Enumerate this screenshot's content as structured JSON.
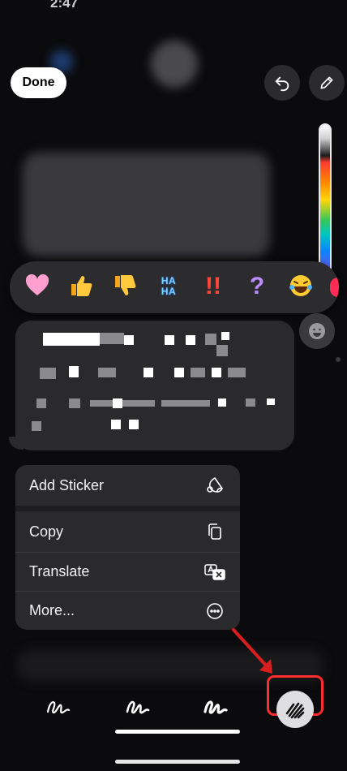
{
  "status": {
    "time": "2:47"
  },
  "toolbar": {
    "done_label": "Done",
    "undo_icon": "undo-icon",
    "pen_icon": "pencil-icon"
  },
  "reactions": [
    "heart",
    "thumbs-up",
    "thumbs-down",
    "HA HA",
    "!!",
    "?",
    "laughing"
  ],
  "reaction_haha_top": "HA",
  "reaction_haha_bottom": "HA",
  "reaction_exclaim": "!!",
  "reaction_question": "?",
  "menu": {
    "items": [
      {
        "label": "Add Sticker",
        "icon": "sticker-icon"
      },
      {
        "label": "Copy",
        "icon": "copy-icon"
      },
      {
        "label": "Translate",
        "icon": "translate-icon"
      },
      {
        "label": "More...",
        "icon": "ellipsis-circle-icon"
      }
    ]
  },
  "drawing_tools": [
    "pen-tool-1",
    "pen-tool-2",
    "pen-tool-3",
    "pen-tool-4-active"
  ],
  "colors": {
    "highlight": "#ff2d2d",
    "arrow": "#d81e1e",
    "menu_bg": "#2a2a2d"
  }
}
